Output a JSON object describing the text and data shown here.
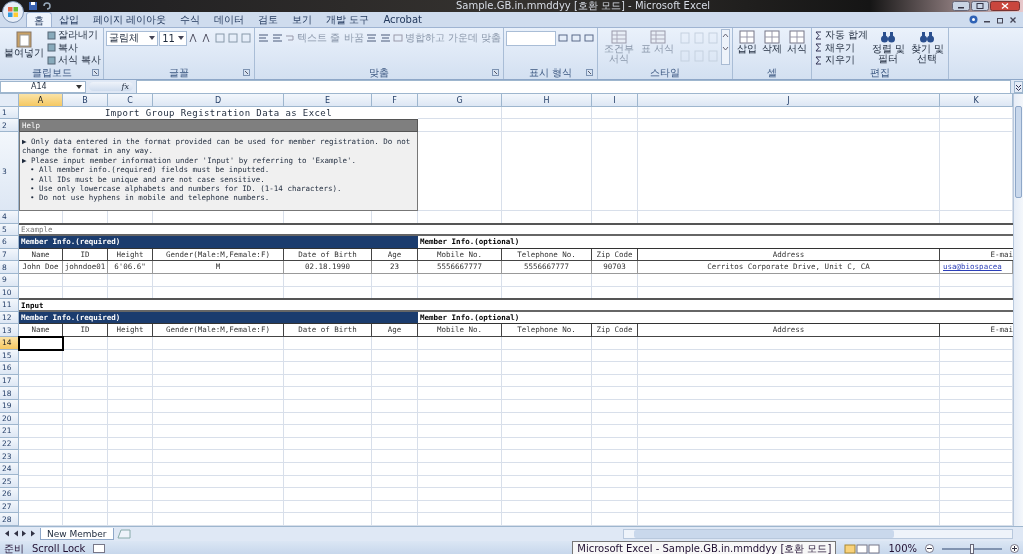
{
  "window": {
    "title": "Sample.GB.in.mmddyy [호환 모드] - Microsoft Excel"
  },
  "ribbon_tabs": [
    {
      "label": "홈",
      "selected": true
    },
    {
      "label": "삽입",
      "selected": false
    },
    {
      "label": "페이지 레이아웃",
      "selected": false
    },
    {
      "label": "수식",
      "selected": false
    },
    {
      "label": "데이터",
      "selected": false
    },
    {
      "label": "검토",
      "selected": false
    },
    {
      "label": "보기",
      "selected": false
    },
    {
      "label": "개발 도구",
      "selected": false
    },
    {
      "label": "Acrobat",
      "selected": false
    }
  ],
  "ribbon_groups": [
    {
      "kind": "clipboard",
      "label": "클립보드",
      "large": "붙여넣기",
      "small": [
        "잘라내기",
        "복사",
        "서식 복사"
      ]
    },
    {
      "kind": "font",
      "label": "글꼴",
      "font": "굴림체",
      "size": "11"
    },
    {
      "kind": "alignment",
      "label": "맞춤",
      "wrap": "텍스트 줄 바꿈",
      "merge": "병합하고 가운데 맞춤"
    },
    {
      "kind": "number",
      "label": "표시 형식"
    },
    {
      "kind": "styles",
      "label": "스타일",
      "buttons": [
        "조건부 서식",
        "표 서식"
      ]
    },
    {
      "kind": "cells",
      "label": "셀",
      "buttons": [
        "삽입",
        "삭제",
        "서식"
      ]
    },
    {
      "kind": "editing",
      "label": "편집",
      "small": [
        "자동 합계",
        "채우기",
        "지우기"
      ],
      "buttons": [
        "정렬 및 필터",
        "찾기 및 선택"
      ]
    }
  ],
  "formula_bar": {
    "name_box": "A14",
    "function_label": "fx"
  },
  "columns": [
    {
      "label": "A",
      "selected": true
    },
    {
      "label": "B",
      "selected": false
    },
    {
      "label": "C",
      "selected": false
    },
    {
      "label": "D",
      "selected": false
    },
    {
      "label": "E",
      "selected": false
    },
    {
      "label": "F",
      "selected": false
    },
    {
      "label": "G",
      "selected": false
    },
    {
      "label": "H",
      "selected": false
    },
    {
      "label": "I",
      "selected": false
    },
    {
      "label": "J",
      "selected": false
    },
    {
      "label": "K",
      "selected": false
    }
  ],
  "rows": [
    {
      "label": "1",
      "selected": false
    },
    {
      "label": "2",
      "selected": false
    },
    {
      "label": "3",
      "selected": false
    },
    {
      "label": "4",
      "selected": false
    },
    {
      "label": "5",
      "selected": false
    },
    {
      "label": "6",
      "selected": false
    },
    {
      "label": "7",
      "selected": false
    },
    {
      "label": "8",
      "selected": false
    },
    {
      "label": "9",
      "selected": false
    },
    {
      "label": "10",
      "selected": false
    },
    {
      "label": "11",
      "selected": false
    },
    {
      "label": "12",
      "selected": false
    },
    {
      "label": "13",
      "selected": false
    },
    {
      "label": "14",
      "selected": true
    },
    {
      "label": "15",
      "selected": false
    },
    {
      "label": "16",
      "selected": false
    },
    {
      "label": "17",
      "selected": false
    },
    {
      "label": "18",
      "selected": false
    },
    {
      "label": "19",
      "selected": false
    },
    {
      "label": "20",
      "selected": false
    },
    {
      "label": "21",
      "selected": false
    },
    {
      "label": "22",
      "selected": false
    },
    {
      "label": "23",
      "selected": false
    },
    {
      "label": "24",
      "selected": false
    },
    {
      "label": "25",
      "selected": false
    },
    {
      "label": "26",
      "selected": false
    },
    {
      "label": "27",
      "selected": false
    },
    {
      "label": "28",
      "selected": false
    }
  ],
  "sheet": {
    "title": "Import Group Registration Data as Excel",
    "help": {
      "heading": "Help",
      "lines": [
        {
          "kind": "main",
          "text": "▶ Only data entered in the format provided can be used for member registration. Do not change the format in any way."
        },
        {
          "kind": "main",
          "text": "▶ Please input member information under 'Input' by referring to 'Example'."
        },
        {
          "kind": "bullet",
          "text": "• All member info.(required) fields must be inputted."
        },
        {
          "kind": "bullet",
          "text": "• All IDs must be unique and are not case sensitive."
        },
        {
          "kind": "bullet",
          "text": "• Use only lowercase alphabets and numbers for ID. (1-14 characters)."
        },
        {
          "kind": "bullet",
          "text": "• Do not use hyphens in mobile and telephone numbers."
        }
      ]
    },
    "sections": [
      {
        "kind": "example",
        "label": "Example",
        "required_heading": "Member Info.(required)",
        "optional_heading": "Member Info.(optional)",
        "columns": [
          "Name",
          "ID",
          "Height",
          "Gender(Male:M,Female:F)",
          "Date of Birth",
          "Age",
          "Mobile No.",
          "Telephone No.",
          "Zip Code",
          "Address",
          "E-mai"
        ],
        "rows": [
          [
            {
              "kind": "text",
              "text": "John Doe"
            },
            {
              "kind": "text",
              "text": "johndoe01"
            },
            {
              "kind": "text",
              "text": "6'06.6\""
            },
            {
              "kind": "text",
              "text": "M"
            },
            {
              "kind": "text",
              "text": "02.18.1990"
            },
            {
              "kind": "text",
              "text": "23"
            },
            {
              "kind": "text",
              "text": "5556667777"
            },
            {
              "kind": "text",
              "text": "5556667777"
            },
            {
              "kind": "text",
              "text": "90703"
            },
            {
              "kind": "text",
              "text": "Cerritos Corporate Drive, Unit C, CA"
            },
            {
              "kind": "link",
              "text": "usa@biospacea"
            }
          ]
        ]
      },
      {
        "kind": "input",
        "label": "Input",
        "required_heading": "Member Info.(required)",
        "optional_heading": "Member Info.(optional)",
        "columns": [
          "Name",
          "ID",
          "Height",
          "Gender(Male:M,Female:F)",
          "Date of Birth",
          "Age",
          "Mobile No.",
          "Telephone No.",
          "Zip Code",
          "Address",
          "E-mai"
        ]
      }
    ]
  },
  "sheet_tabs": [
    {
      "label": "New Member",
      "selected": true
    }
  ],
  "status_bar": {
    "mode": "준비",
    "scroll_lock": "Scroll Lock",
    "taskbar_tooltip": "Microsoft Excel - Sample.GB.in.mmddyy [호환 모드]",
    "zoom": "100%",
    "zoom_slider": {
      "level": 0.5
    }
  }
}
